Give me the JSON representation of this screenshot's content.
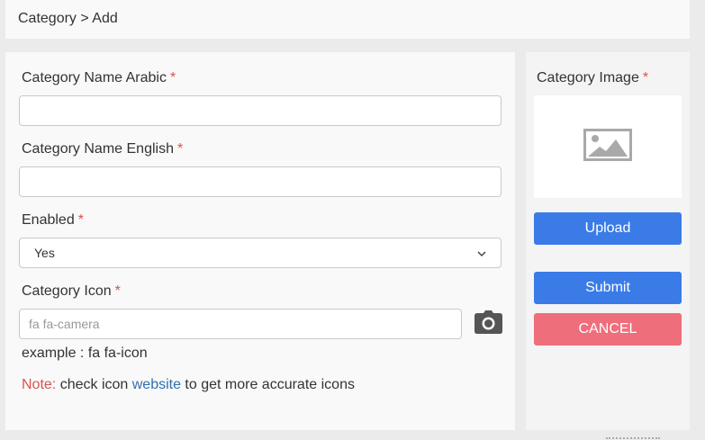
{
  "breadcrumb": "Category > Add",
  "form": {
    "name_arabic": {
      "label": "Category Name Arabic",
      "required_mark": "*",
      "value": ""
    },
    "name_english": {
      "label": "Category Name English",
      "required_mark": "*",
      "value": ""
    },
    "enabled": {
      "label": "Enabled",
      "required_mark": "*",
      "selected": "Yes",
      "chevron": "⌄"
    },
    "icon": {
      "label": "Category Icon",
      "required_mark": "*",
      "placeholder": "fa fa-camera",
      "icon_name": "camera-icon"
    },
    "example": "example : fa fa-icon",
    "note": {
      "prefix": "Note:",
      "text_before_link": " check icon ",
      "link_text": "website",
      "text_after_link": " to get more accurate icons"
    }
  },
  "side": {
    "image_label": "Category Image",
    "required_mark": "*",
    "image_placeholder_icon": "image-icon",
    "upload_label": "Upload",
    "submit_label": "Submit",
    "cancel_label": "CANCEL"
  },
  "colors": {
    "primary": "#3a7be8",
    "danger": "#ee6e7b",
    "required": "#d9534f",
    "link": "#2f6fb0"
  }
}
